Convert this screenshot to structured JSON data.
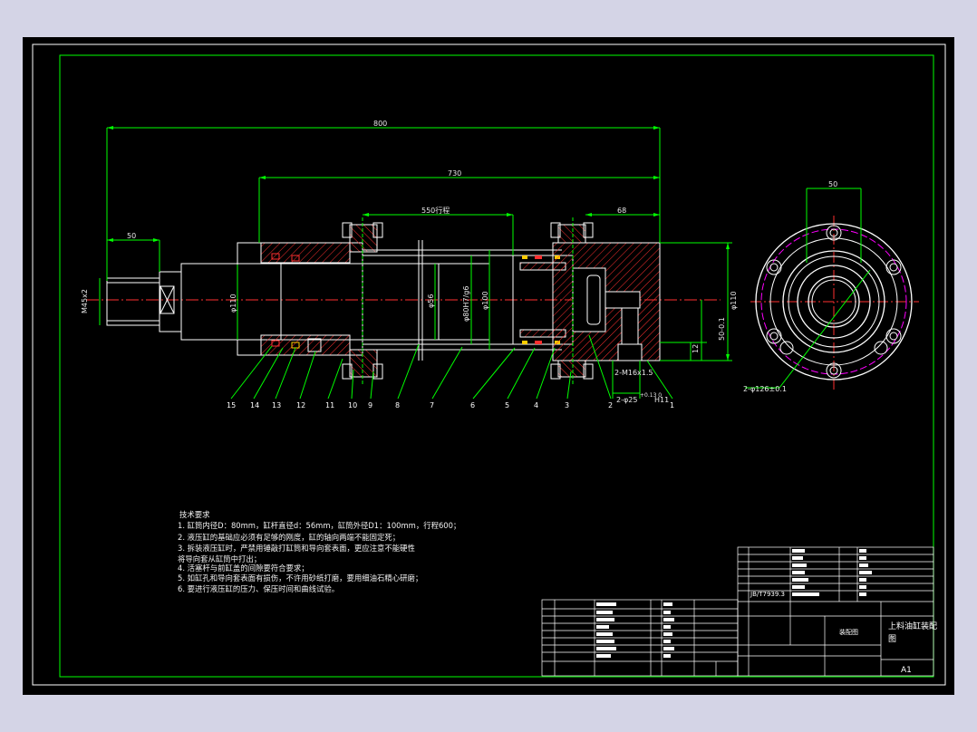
{
  "drawing": {
    "dimensions": {
      "overall_length": "800",
      "body_length": "730",
      "stroke_length": "550行程",
      "rod_end": "50",
      "right_offset": "68",
      "thread": "M45x2",
      "rod_dia": "φ110",
      "bore_a": "φ56",
      "bore_b": "φ80H7/g6",
      "bore_c": "φ100",
      "right_dia": "φ110",
      "right_height": "50-0.1",
      "right_small": "12",
      "port_a": "2-M16x1.5",
      "port_b": "2-φ25",
      "port_b_tol": "+0.13\n0",
      "port_c": "H11",
      "side_width": "50",
      "side_holes": "2-φ126±0.1"
    },
    "part_numbers": [
      "15",
      "14",
      "13",
      "12",
      "11",
      "10",
      "9",
      "8",
      "7",
      "6",
      "5",
      "4",
      "3",
      "2",
      "1"
    ],
    "tech_requirements": {
      "title": "技术要求",
      "lines": [
        "1. 缸筒内径D：80mm，缸杆直径d：56mm，缸筒外径D1：100mm，行程600；",
        "2. 液压缸的基础应必须有足够的刚度，缸的轴向两端不能固定死；",
        "3. 拆装液压缸时，严禁用锤敲打缸筒和导向套表面，更应注意不能硬性",
        "将导向套从缸筒中打出；",
        "4. 活塞杆与前缸盖的间隙要符合要求；",
        "5. 如缸孔和导向套表面有损伤，不许用砂纸打磨，要用细油石精心研磨；",
        "6. 要进行液压缸的压力、保压时间和曲线试验。"
      ]
    },
    "title_block": {
      "name": "上料油缸装配",
      "name2": "图",
      "sheet": "A1",
      "label_a": "装配图",
      "std": "JB/T7939.3"
    }
  },
  "colors": {
    "background": "#000000",
    "frame": "#00ff00",
    "body": "#ffffff",
    "centerline": "#ff3030",
    "dimension": "#00ff00",
    "hatch": "#ff3030",
    "hidden": "#ff00ff"
  }
}
